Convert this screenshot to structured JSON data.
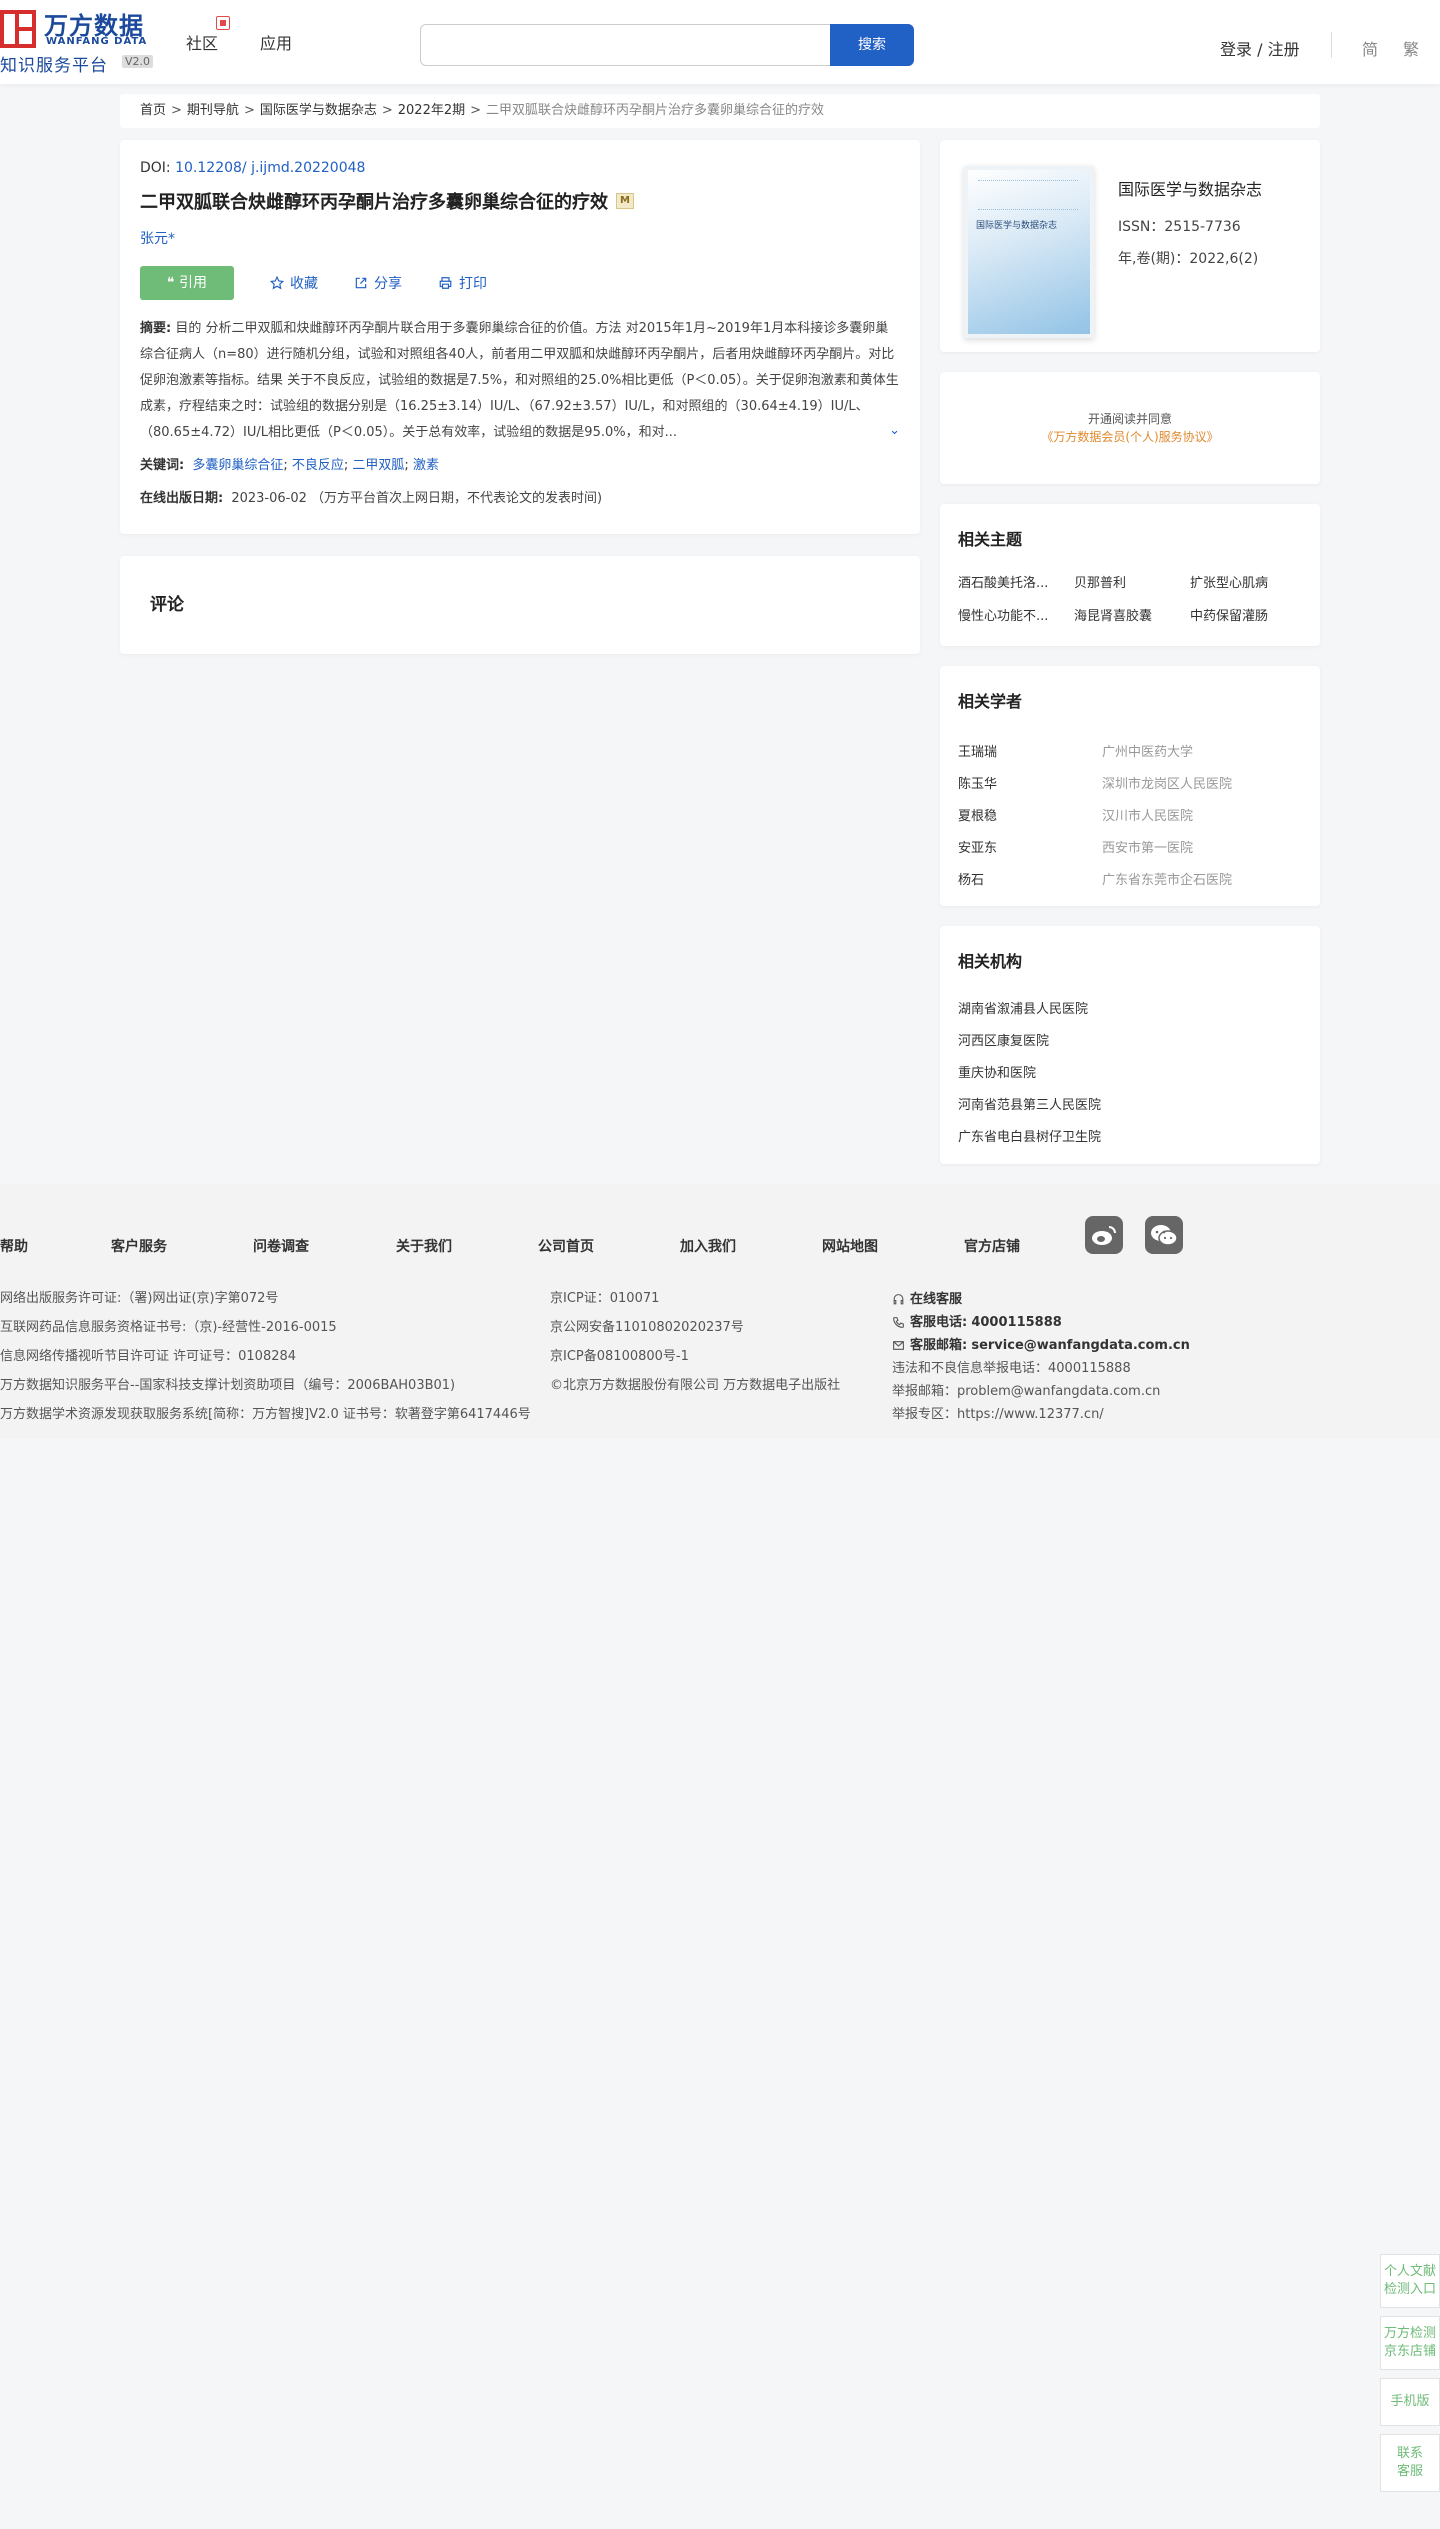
{
  "header": {
    "logo_cn": "万方数据",
    "logo_en": "WANFANG DATA",
    "logo_sub": "知识服务平台",
    "logo_version": "V2.0",
    "nav": [
      "社区",
      "应用"
    ],
    "search_placeholder": "",
    "search_button": "搜索",
    "login": "登录 / 注册",
    "lang_simplified": "简",
    "lang_traditional": "繁"
  },
  "breadcrumb": [
    "首页",
    "期刊导航",
    "国际医学与数据杂志",
    "2022年2期",
    "二甲双胍联合炔雌醇环丙孕酮片治疗多囊卵巢综合征的疗效"
  ],
  "article": {
    "doi_label": "DOI: ",
    "doi": "10.12208/ j.ijmd.20220048",
    "title": "二甲双胍联合炔雌醇环丙孕酮片治疗多囊卵巢综合征的疗效",
    "title_tag": "M",
    "author": "张元*",
    "actions": {
      "cite": "引用",
      "favorite": "收藏",
      "share": "分享",
      "print": "打印"
    },
    "abstract_label": "摘要:",
    "abstract": "目的 分析二甲双胍和炔雌醇环丙孕酮片联合用于多囊卵巢综合征的价值。方法 对2015年1月~2019年1月本科接诊多囊卵巢综合征病人（n=80）进行随机分组，试验和对照组各40人，前者用二甲双胍和炔雌醇环丙孕酮片，后者用炔雌醇环丙孕酮片。对比促卵泡激素等指标。结果 关于不良反应，试验组的数据是7.5%，和对照组的25.0%相比更低（P＜0.05）。关于促卵泡激素和黄体生成素，疗程结束之时：试验组的数据分别是（16.25±3.14）IU/L、（67.92±3.57）IU/L，和对照组的（30.64±4.19）IU/L、（80.65±4.72）IU/L相比更低（P＜0.05）。关于总有效率，试验组的数据是95.0%，和对...",
    "keywords_label": "关键词:",
    "keywords": [
      "多囊卵巢综合征",
      "不良反应",
      "二甲双胍",
      "激素"
    ],
    "pubdate_label": "在线出版日期:",
    "pubdate": "2023-06-02 （万方平台首次上网日期，不代表论文的发表时间)"
  },
  "comments": {
    "title": "评论"
  },
  "journal": {
    "cover_title": "国际医学与数据杂志",
    "name": "国际医学与数据杂志",
    "issn": "ISSN：2515-7736",
    "volume": "年,卷(期)：2022,6(2)"
  },
  "open_read": {
    "line1": "开通阅读并同意",
    "line2": "《万方数据会员(个人)服务协议》"
  },
  "related_topics": {
    "title": "相关主题",
    "items": [
      "酒石酸美托洛...",
      "贝那普利",
      "扩张型心肌病",
      "慢性心功能不...",
      "海昆肾喜胶囊",
      "中药保留灌肠"
    ]
  },
  "related_scholars": {
    "title": "相关学者",
    "items": [
      {
        "name": "王瑞瑞",
        "org": "广州中医药大学"
      },
      {
        "name": "陈玉华",
        "org": "深圳市龙岗区人民医院"
      },
      {
        "name": "夏根稳",
        "org": "汉川市人民医院"
      },
      {
        "name": "安亚东",
        "org": "西安市第一医院"
      },
      {
        "name": "杨石",
        "org": "广东省东莞市企石医院"
      }
    ]
  },
  "related_institutions": {
    "title": "相关机构",
    "items": [
      "湖南省溆浦县人民医院",
      "河西区康复医院",
      "重庆协和医院",
      "河南省范县第三人民医院",
      "广东省电白县树仔卫生院"
    ]
  },
  "footer": {
    "links": [
      "帮助",
      "客户服务",
      "问卷调查",
      "关于我们",
      "公司首页",
      "加入我们",
      "网站地图",
      "官方店铺"
    ],
    "col1": [
      "网络出版服务许可证:（署)网出证(京)字第072号",
      "互联网药品信息服务资格证书号:（京)-经营性-2016-0015",
      "信息网络传播视听节目许可证 许可证号：0108284",
      "万方数据知识服务平台--国家科技支撑计划资助项目（编号：2006BAH03B01)",
      "万方数据学术资源发现获取服务系统[简称：万方智搜]V2.0 证书号：软著登字第6417446号"
    ],
    "col2": [
      "京ICP证：010071",
      "京公网安备11010802020237号",
      "京ICP备08100800号-1",
      "©北京万方数据股份有限公司 万方数据电子出版社"
    ],
    "online_service": "在线客服",
    "phone_label": "客服电话:",
    "phone": "4000115888",
    "email_label": "客服邮箱:",
    "email": "service@wanfangdata.com.cn",
    "report_phone": "违法和不良信息举报电话：4000115888",
    "report_email": "举报邮箱：problem@wanfangdata.com.cn",
    "report_zone": "举报专区：https://www.12377.cn/"
  },
  "float_tools": [
    "个人文献检测入口",
    "万方检测京东店铺",
    "手机版",
    "联系客服"
  ],
  "colors": {
    "brand_blue": "#1b4a9c",
    "link_blue": "#2160c4",
    "cite_green": "#6fbb78",
    "logo_red": "#d62d2d",
    "agreement_orange": "#e08a2d"
  }
}
